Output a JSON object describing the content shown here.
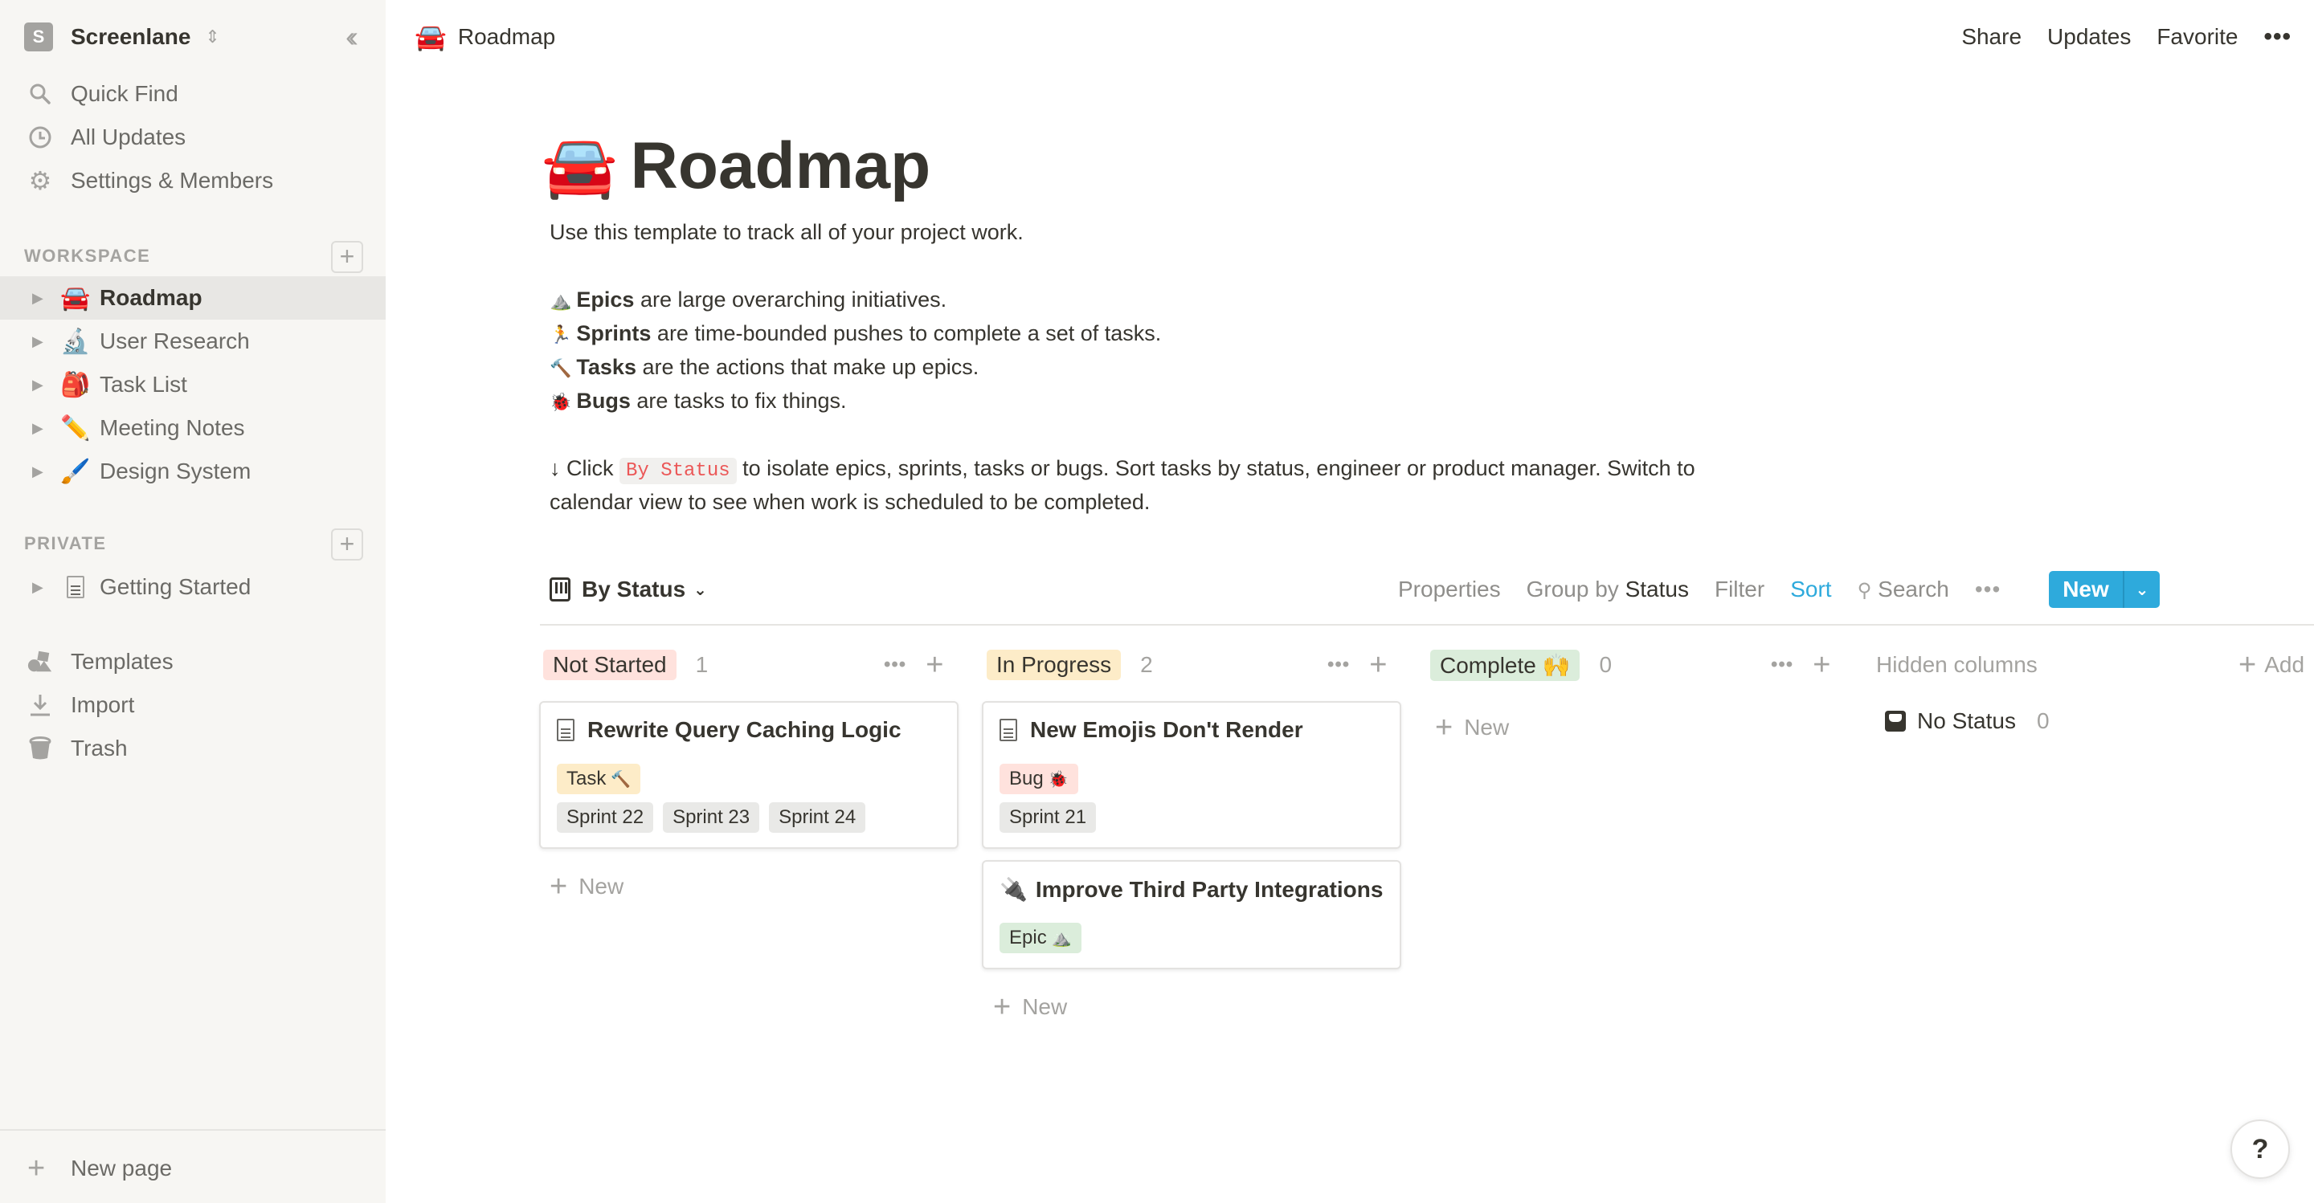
{
  "sidebar": {
    "workspace": {
      "initial": "S",
      "name": "Screenlane"
    },
    "nav": [
      {
        "icon": "search-icon",
        "label": "Quick Find"
      },
      {
        "icon": "clock-icon",
        "label": "All Updates"
      },
      {
        "icon": "gear-icon",
        "label": "Settings & Members"
      }
    ],
    "workspace_section": {
      "label": "WORKSPACE",
      "pages": [
        {
          "emoji": "🚘",
          "label": "Roadmap",
          "active": true
        },
        {
          "emoji": "🔬",
          "label": "User Research"
        },
        {
          "emoji": "🎒",
          "label": "Task List"
        },
        {
          "emoji": "✏️",
          "label": "Meeting Notes"
        },
        {
          "emoji": "🖌️",
          "label": "Design System"
        }
      ]
    },
    "private_section": {
      "label": "PRIVATE",
      "pages": [
        {
          "emoji": "📄",
          "label": "Getting Started"
        }
      ]
    },
    "bottom_nav": [
      {
        "icon": "templates-icon",
        "label": "Templates"
      },
      {
        "icon": "import-icon",
        "label": "Import"
      },
      {
        "icon": "trash-icon",
        "label": "Trash"
      }
    ],
    "new_page_label": "New page"
  },
  "topbar": {
    "breadcrumb_emoji": "🚘",
    "breadcrumb": "Roadmap",
    "actions": {
      "share": "Share",
      "updates": "Updates",
      "favorite": "Favorite",
      "more": "•••"
    }
  },
  "page": {
    "emoji": "🚘",
    "title": "Roadmap",
    "intro": "Use this template to track all of your project work.",
    "definitions": [
      {
        "emoji": "⛰️",
        "term": "Epics",
        "text": " are large overarching initiatives."
      },
      {
        "emoji": "🏃",
        "term": "Sprints",
        "text": " are time-bounded pushes to complete a set of tasks."
      },
      {
        "emoji": "🔨",
        "term": "Tasks",
        "text": " are the actions that make up epics."
      },
      {
        "emoji": "🐞",
        "term": "Bugs",
        "text": " are tasks to fix things."
      }
    ],
    "instruction": {
      "prefix": "↓ Click ",
      "code": "By Status",
      "line1_rest": " to isolate epics, sprints, tasks or bugs. Sort tasks by status, engineer or product manager. Switch to",
      "line2": "calendar view to see when work is scheduled to be completed."
    }
  },
  "database": {
    "view_name": "By Status",
    "toolbar": {
      "properties": "Properties",
      "group_by_prefix": "Group by ",
      "group_by_value": "Status",
      "filter": "Filter",
      "sort": "Sort",
      "search": "Search",
      "more": "•••",
      "new": "New",
      "new_dropdown": "⌄"
    },
    "columns": [
      {
        "status": "Not Started",
        "color": "#ffe2dd",
        "count": "1",
        "cards": [
          {
            "icon": "doc",
            "title": "Rewrite Query Caching Logic",
            "type": {
              "label": "Task",
              "emoji": "🔨",
              "color": "#fdecc8"
            },
            "sprints": [
              "Sprint 22",
              "Sprint 23",
              "Sprint 24"
            ]
          }
        ]
      },
      {
        "status": "In Progress",
        "color": "#fdecc8",
        "count": "2",
        "cards": [
          {
            "icon": "doc",
            "title": "New Emojis Don't Render",
            "type": {
              "label": "Bug",
              "emoji": "🐞",
              "color": "#ffe2dd"
            },
            "sprints": [
              "Sprint 21"
            ]
          },
          {
            "icon": "emoji",
            "emoji": "🔌",
            "title": "Improve Third Party Integrations",
            "type": {
              "label": "Epic",
              "emoji": "⛰️",
              "color": "#dbeddb"
            },
            "sprints": []
          }
        ]
      },
      {
        "status": "Complete 🙌",
        "color": "#dbeddb",
        "count": "0",
        "cards": []
      }
    ],
    "new_label": "New",
    "hidden_columns_label": "Hidden columns",
    "add_group_label": "Add",
    "no_status": {
      "label": "No Status",
      "count": "0"
    }
  },
  "help_label": "?"
}
